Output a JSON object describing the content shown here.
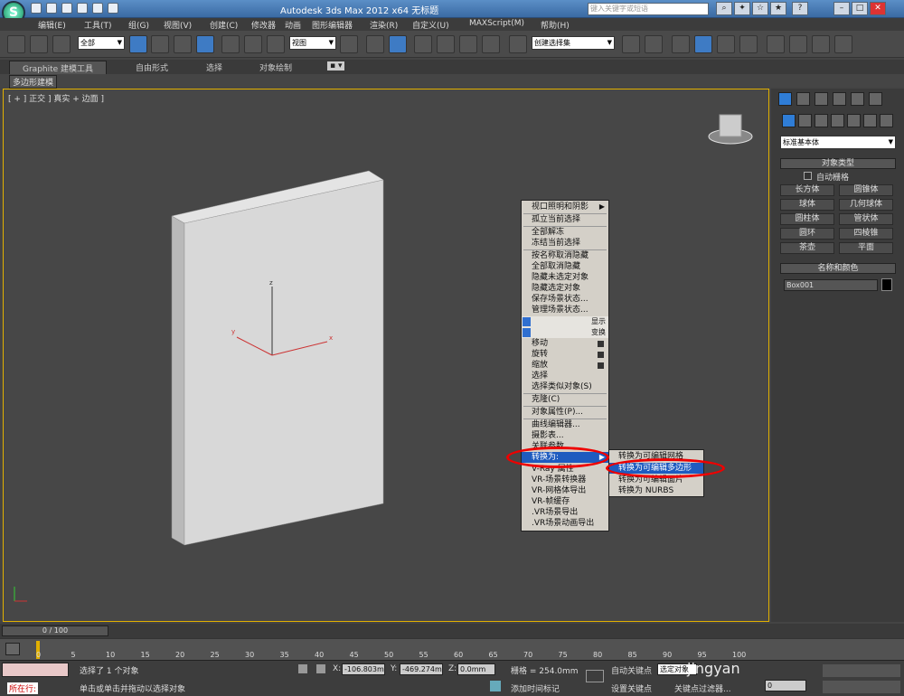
{
  "window": {
    "title": "Autodesk 3ds Max  2012 x64      无标题",
    "search_placeholder": "键入关键字或短语",
    "logo_letter": "S"
  },
  "menu": [
    "编辑(E)",
    "工具(T)",
    "组(G)",
    "视图(V)",
    "创建(C)",
    "修改器",
    "动画",
    "图形编辑器",
    "渲染(R)",
    "自定义(U)",
    "MAXScript(M)",
    "帮助(H)"
  ],
  "toolbar": {
    "selection_filter": "全部",
    "reference_coord": "视图",
    "named_selection": "创建选择集"
  },
  "ribbon": {
    "tabs": [
      "Graphite 建模工具",
      "自由形式",
      "选择",
      "对象绘制"
    ],
    "sub_label": "多边形建模"
  },
  "viewport": {
    "label": "[ + ] 正交 ] 真实 + 边面 ]",
    "axis_x": "x",
    "axis_y": "y",
    "axis_z": "z"
  },
  "context_menu": {
    "items": [
      {
        "label": "视口照明和阴影",
        "arrow": "▶"
      },
      {
        "label": "孤立当前选择"
      },
      {
        "label": "全部解冻"
      },
      {
        "label": "冻结当前选择"
      },
      {
        "label": "按名称取消隐藏"
      },
      {
        "label": "全部取消隐藏"
      },
      {
        "label": "隐藏未选定对象"
      },
      {
        "label": "隐藏选定对象"
      },
      {
        "label": "保存场景状态..."
      },
      {
        "label": "管理场景状态..."
      },
      {
        "label": "移动"
      },
      {
        "label": "旋转"
      },
      {
        "label": "缩放"
      },
      {
        "label": "选择"
      },
      {
        "label": "选择类似对象(S)"
      },
      {
        "label": "克隆(C)"
      },
      {
        "label": "对象属性(P)..."
      },
      {
        "label": "曲线编辑器..."
      },
      {
        "label": "摄影表..."
      },
      {
        "label": "关联参数"
      },
      {
        "label": "转换为:",
        "arrow": "▶"
      },
      {
        "label": "V-Ray 属性"
      },
      {
        "label": "VR-场景转换器"
      },
      {
        "label": "VR-网格体导出"
      },
      {
        "label": "VR-帧缓存"
      },
      {
        "label": ".VR场景导出"
      },
      {
        "label": ".VR场景动画导出"
      }
    ],
    "section_display": "显示",
    "section_transform": "变换",
    "submenu": [
      "转换为可编辑网格",
      "转换为可编辑多边形",
      "转换为可编辑面片",
      "转换为 NURBS"
    ]
  },
  "command_panel": {
    "category": "标准基本体",
    "object_type_title": "对象类型",
    "autogrid": "自动栅格",
    "buttons": [
      "长方体",
      "圆锥体",
      "球体",
      "几何球体",
      "圆柱体",
      "管状体",
      "圆环",
      "四棱锥",
      "茶壶",
      "平面"
    ],
    "name_color_title": "名称和颜色",
    "object_name": "Box001"
  },
  "timeline": {
    "slider": "0 / 100",
    "ticks": [
      "0",
      "5",
      "10",
      "15",
      "20",
      "25",
      "30",
      "35",
      "40",
      "45",
      "50",
      "55",
      "60",
      "65",
      "70",
      "75",
      "80",
      "85",
      "90",
      "95",
      "100"
    ]
  },
  "status": {
    "selected_text": "选择了 1 个对象",
    "prompt_text": "单击或单击并拖动以选择对象",
    "listener": "所在行:",
    "x_label": "X:",
    "x_value": "-106.803m",
    "y_label": "Y:",
    "y_value": "-469.274m",
    "z_label": "Z:",
    "z_value": "0.0mm",
    "grid": "栅格 = 254.0mm",
    "auto_key": "自动关键点",
    "selected_objects": "选定对象",
    "set_key": "设置关键点",
    "key_filters": "关键点过滤器...",
    "add_time_tag": "添加时间标记",
    "frame": "0"
  },
  "watermark": "jingyan"
}
